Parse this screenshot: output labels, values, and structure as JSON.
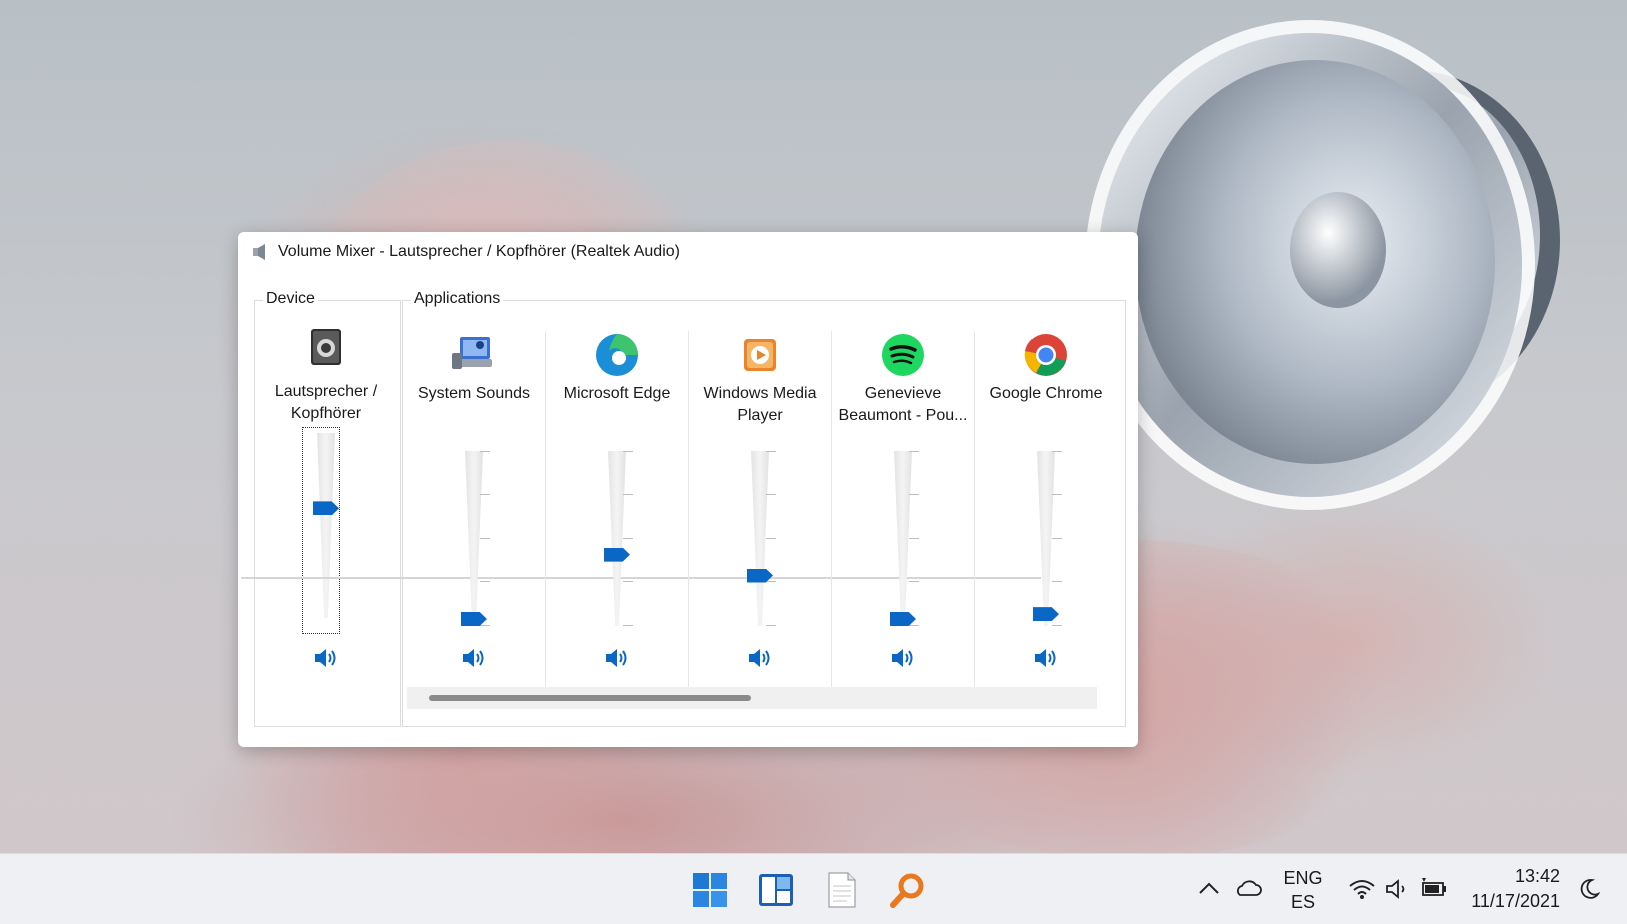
{
  "window": {
    "title": "Volume Mixer - Lautsprecher / Kopfhörer (Realtek Audio)"
  },
  "device_group": {
    "label": "Device",
    "channel": {
      "name": "Lautsprecher / Kopfhörer",
      "level": 0.6
    }
  },
  "applications_group": {
    "label": "Applications",
    "channels": [
      {
        "name": "System Sounds",
        "icon": "system-sounds-icon",
        "level": 0.0
      },
      {
        "name": "Microsoft Edge",
        "icon": "edge-icon",
        "level": 0.4
      },
      {
        "name": "Windows Media Player",
        "icon": "media-player-icon",
        "level": 0.27
      },
      {
        "name": "Genevieve Beaumont - Pou...",
        "icon": "spotify-icon",
        "level": 0.0
      },
      {
        "name": "Google Chrome",
        "icon": "chrome-icon",
        "level": 0.03
      }
    ]
  },
  "taskbar": {
    "apps": [
      "start-icon",
      "widgets-icon",
      "notepad-icon",
      "search-app-icon"
    ],
    "language_line1": "ENG",
    "language_line2": "ES",
    "time": "13:42",
    "date": "11/17/2021"
  },
  "colors": {
    "accent": "#0a67c6",
    "window_bg": "#ffffff",
    "taskbar_bg": "#eef0f3"
  }
}
